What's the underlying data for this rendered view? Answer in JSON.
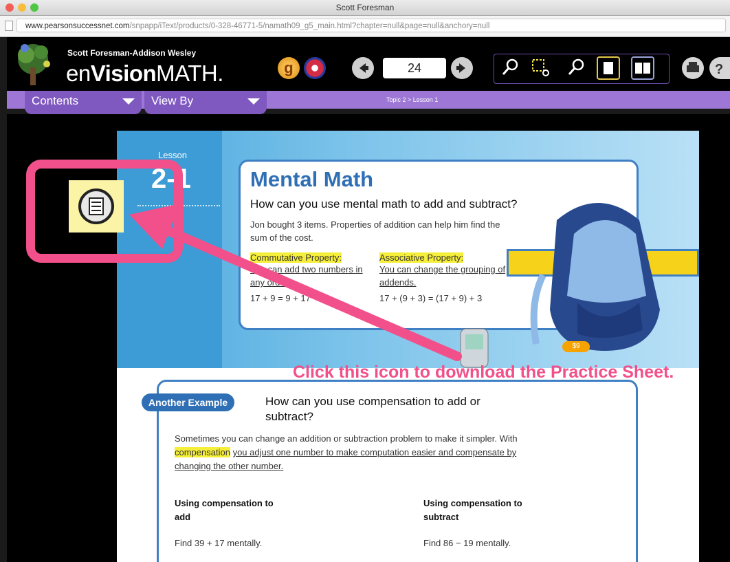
{
  "window": {
    "title": "Scott Foresman",
    "url_host": "www.pearsonsuccessnet.com",
    "url_path": "/snpapp/iText/products/0-328-46771-5/namath09_g5_main.html?chapter=null&page=null&anchory=null"
  },
  "header": {
    "publisher": "Scott Foresman-Addison Wesley",
    "logo_en": "en",
    "logo_vision": "Vision",
    "logo_math": "MATH",
    "g_icon_label": "g",
    "page_number": "24"
  },
  "nav": {
    "contents_label": "Contents",
    "viewby_label": "View By",
    "breadcrumb": "Topic 2 > Lesson 1"
  },
  "lesson": {
    "label": "Lesson",
    "number": "2-1"
  },
  "mental_math": {
    "title": "Mental Math",
    "question": "How can you use mental math to add and subtract?",
    "intro": "Jon bought 3 items. Properties of addition can help him find the sum of the cost.",
    "commutative_label": "Commutative Property:",
    "commutative_desc": "You can add two numbers in any order.",
    "commutative_eq": "17 + 9 = 9 + 17",
    "associative_label": "Associative Property:",
    "associative_desc": "You can change the grouping of addends.",
    "associative_eq": "17 + (9 + 3) = (17 + 9) + 3",
    "price_tag": "$9"
  },
  "another_example": {
    "badge": "Another Example",
    "question": "How can you use compensation to add or subtract?",
    "text_pre": "Sometimes you can change an addition or subtraction problem to make it simpler. With",
    "compensation_word": "compensation",
    "text_post": "you adjust one number to make computation easier and compensate by changing the other number.",
    "col1_title": "Using compensation to add",
    "col1_task": "Find 39 + 17 mentally.",
    "col2_title": "Using compensation to subtract",
    "col2_task": "Find 86 − 19 mentally."
  },
  "annotation": {
    "callout": "Click this icon to download the Practice Sheet."
  },
  "colors": {
    "purple": "#9e77d6",
    "annotation_pink": "#f2508a",
    "highlight_yellow": "#f6ef3a",
    "title_blue": "#2f6fb5"
  }
}
